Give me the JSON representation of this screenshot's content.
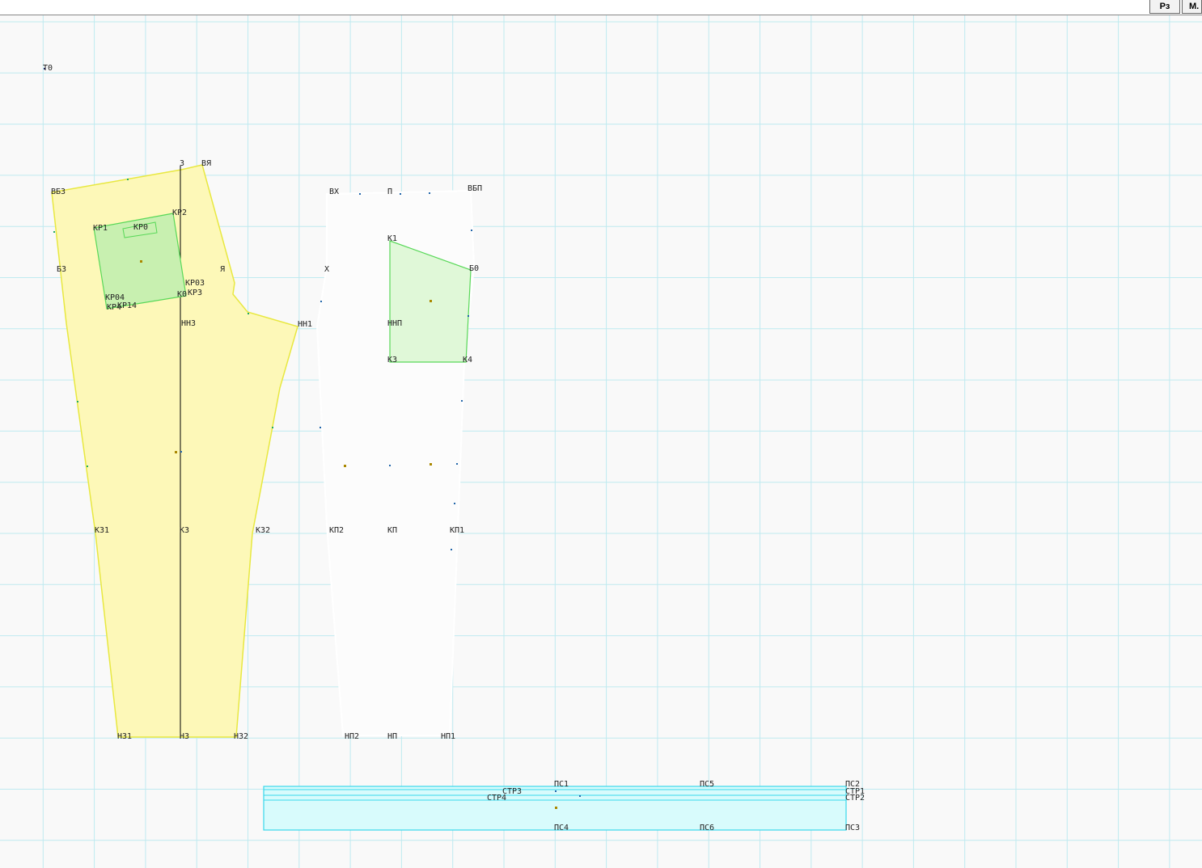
{
  "toolbar": {
    "btn_rz": "Рз",
    "btn_m": "М."
  },
  "colors": {
    "grid": "#bfeaf0",
    "back_piece_fill": "#fdf8b8",
    "back_piece_stroke": "#e8e840",
    "pocket_fill": "#c8f0b0",
    "pocket_stroke": "#58d858",
    "front_pocket_fill": "#e0f8d8",
    "belt_fill": "#d8fbfc",
    "belt_stroke": "#39d8ec",
    "label": "#222222"
  },
  "labels": {
    "t0": "Т0",
    "vbz": "ВБЗ",
    "z": "З",
    "vya": "ВЯ",
    "kr1": "КР1",
    "kr0": "КР0",
    "kr2": "КР2",
    "bz": "БЗ",
    "ya": "Я",
    "kr03": "КР03",
    "kr04": "КР04",
    "kr3": "КР3",
    "kr14": "КР14",
    "kr4": "КР4",
    "k0kr3": "К0",
    "nn3": "НН3",
    "nn1": "НН1",
    "vx": "ВХ",
    "p": "П",
    "vbp": "ВБП",
    "k1": "К1",
    "x": "Х",
    "b0": "Б0",
    "nnp": "ННП",
    "k3": "К3",
    "k4": "К4",
    "kz1": "КЗ1",
    "kz": "КЗ",
    "kz2": "КЗ2",
    "kp2": "КП2",
    "kp": "КП",
    "kp1": "КП1",
    "nz1": "НЗ1",
    "nz": "НЗ",
    "nz2": "НЗ2",
    "np2": "НП2",
    "np": "НП",
    "np1": "НП1",
    "ps1": "ПС1",
    "ps5": "ПС5",
    "ps2": "ПС2",
    "str3": "СТР3",
    "str1": "СТР1",
    "str4": "СТР4",
    "str2": "СТР2",
    "ps4": "ПС4",
    "ps6": "ПС6",
    "ps3": "ПС3"
  }
}
